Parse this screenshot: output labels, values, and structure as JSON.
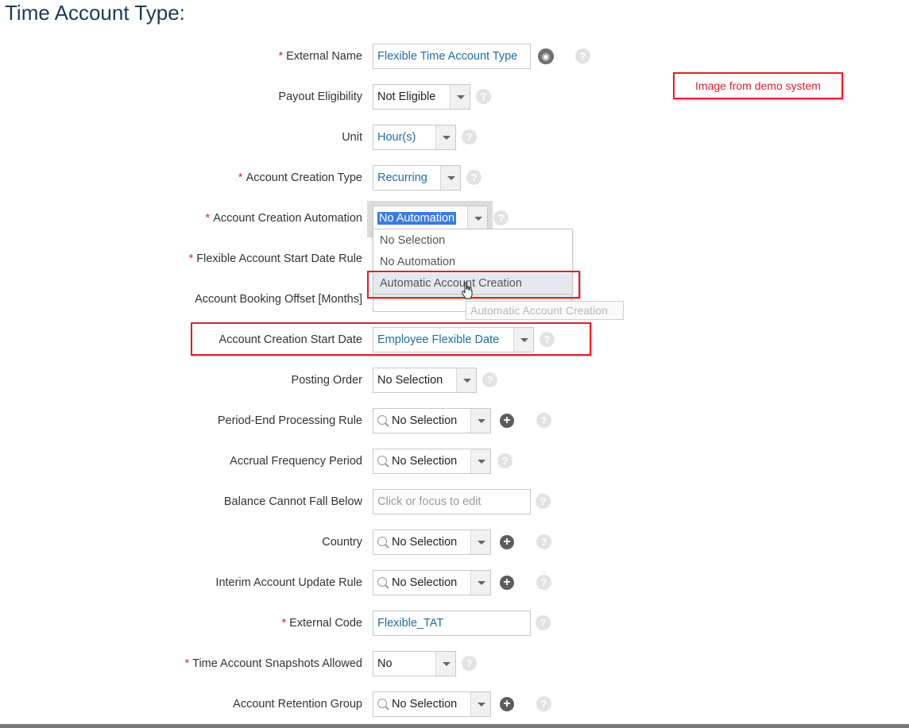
{
  "page": {
    "title": "Time Account Type:"
  },
  "annotation": {
    "text": "Image from demo system"
  },
  "fields": {
    "external_name": {
      "label": "External Name",
      "value": "Flexible Time Account Type"
    },
    "payout_eligibility": {
      "label": "Payout Eligibility",
      "value": "Not Eligible"
    },
    "unit": {
      "label": "Unit",
      "value": "Hour(s)"
    },
    "account_creation_type": {
      "label": "Account Creation Type",
      "value": "Recurring"
    },
    "account_creation_automation": {
      "label": "Account Creation Automation",
      "value": "No Automation"
    },
    "flexible_account_start_date_rule": {
      "label": "Flexible Account Start Date Rule"
    },
    "account_booking_offset": {
      "label": "Account Booking Offset [Months]"
    },
    "account_creation_start_date": {
      "label": "Account Creation Start Date",
      "value": "Employee Flexible Date"
    },
    "posting_order": {
      "label": "Posting Order",
      "value": "No Selection"
    },
    "period_end_processing_rule": {
      "label": "Period-End Processing Rule",
      "value": "No Selection"
    },
    "accrual_frequency_period": {
      "label": "Accrual Frequency Period",
      "value": "No Selection"
    },
    "balance_cannot_fall_below": {
      "label": "Balance Cannot Fall Below",
      "placeholder": "Click or focus to edit"
    },
    "country": {
      "label": "Country",
      "value": "No Selection"
    },
    "interim_account_update_rule": {
      "label": "Interim Account Update Rule",
      "value": "No Selection"
    },
    "external_code": {
      "label": "External Code",
      "value": "Flexible_TAT"
    },
    "time_account_snapshots_allowed": {
      "label": "Time Account Snapshots Allowed",
      "value": "No"
    },
    "account_retention_group": {
      "label": "Account Retention Group",
      "value": "No Selection"
    }
  },
  "dropdown": {
    "options": [
      "No Selection",
      "No Automation",
      "Automatic Account Creation"
    ],
    "hovered_index": 2
  },
  "tooltip": {
    "text": "Automatic Account Creation"
  },
  "colors": {
    "accent_red": "#e0202a",
    "link_blue": "#1f6f9f",
    "required_red": "#d12b2b"
  }
}
